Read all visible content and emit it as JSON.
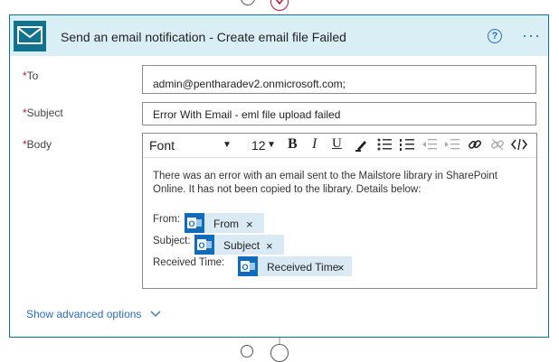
{
  "action": {
    "title": "Send an email notification - Create email file Failed",
    "help_glyph": "?",
    "more_glyph": "···"
  },
  "fields": {
    "to": {
      "star": "*",
      "label": "To",
      "value": "admin@pentharadev2.onmicrosoft.com;"
    },
    "subject": {
      "star": "*",
      "label": "Subject",
      "value": "Error With Email - eml file upload failed"
    },
    "body": {
      "star": "*",
      "label": "Body"
    }
  },
  "toolbar": {
    "font": "Font",
    "size": "12",
    "bold": "B",
    "italic": "I",
    "underline": "U"
  },
  "body_content": {
    "text": "There was an error with an email sent to the Mailstore library in SharePoint Online.   It has not been copied to the library.  Details below:",
    "rows": [
      {
        "label": "From:",
        "token": "From"
      },
      {
        "label": "Subject:",
        "token": "Subject"
      },
      {
        "label": "Received Time:",
        "token": "Received Time"
      }
    ],
    "token_close": "×"
  },
  "show_advanced": "Show advanced options",
  "colors": {
    "accent": "#0f7390",
    "header_bg": "#daeef6",
    "link": "#2b6cc4",
    "required": "#c8102e",
    "token_bg": "#daeaf5",
    "token_icon": "#0f6cbd"
  }
}
